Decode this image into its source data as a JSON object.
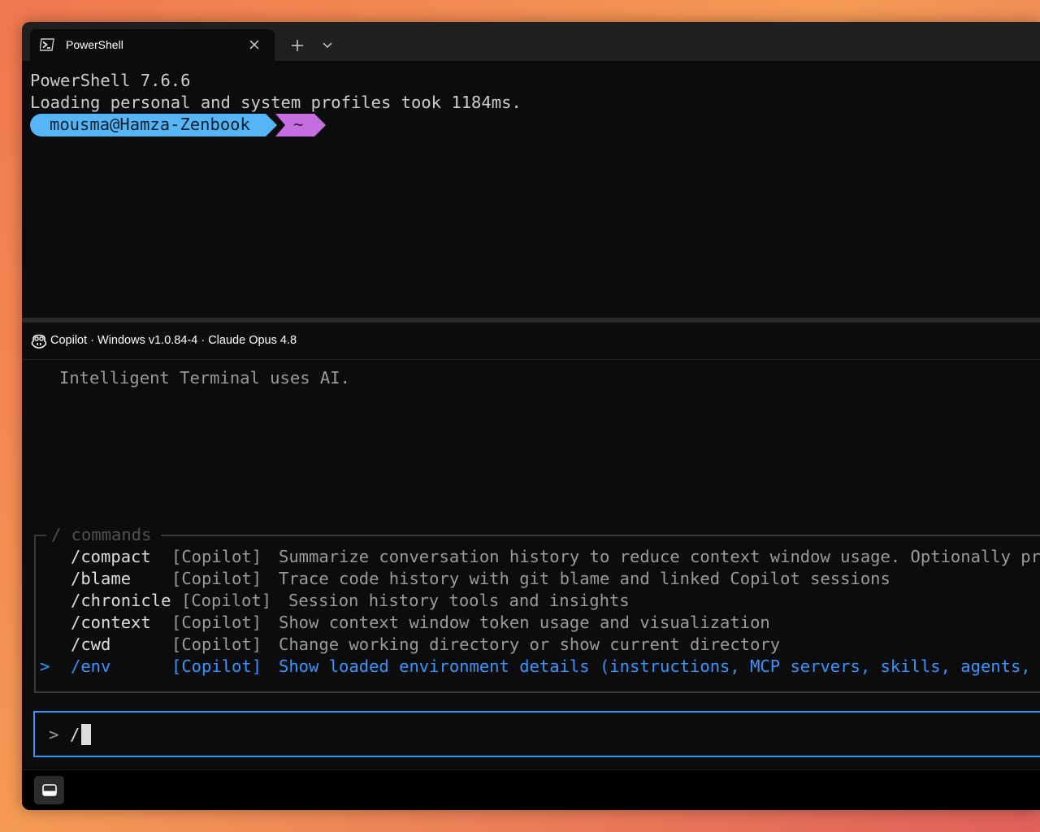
{
  "tab": {
    "title": "PowerShell",
    "icon": "powershell-icon"
  },
  "terminal": {
    "lines": [
      "PowerShell 7.6.6",
      "Loading personal and system profiles took 1184ms."
    ],
    "prompt_user": "mousma@Hamza-Zenbook",
    "prompt_path": "~",
    "colors": {
      "user_segment": "#56b5f5",
      "path_segment": "#c46ee0"
    }
  },
  "copilot": {
    "header": "Copilot · Windows v1.0.84-4 · Claude Opus 4.8",
    "intro": "Intelligent Terminal uses AI.",
    "commands_legend": "/ commands",
    "commands": [
      {
        "name": "/compact",
        "source": "[Copilot]",
        "desc": "Summarize conversation history to reduce context window usage. Optionally pro",
        "selected": false
      },
      {
        "name": "/blame",
        "source": "[Copilot]",
        "desc": "Trace code history with git blame and linked Copilot sessions",
        "selected": false
      },
      {
        "name": "/chronicle",
        "source": "[Copilot]",
        "desc": "Session history tools and insights",
        "selected": false
      },
      {
        "name": "/context",
        "source": "[Copilot]",
        "desc": "Show context window token usage and visualization",
        "selected": false
      },
      {
        "name": "/cwd",
        "source": "[Copilot]",
        "desc": "Change working directory or show current directory",
        "selected": false
      },
      {
        "name": "/env",
        "source": "[Copilot]",
        "desc": "Show loaded environment details (instructions, MCP servers, skills, agents, h",
        "selected": true
      }
    ],
    "selection_marker": ">",
    "input_prompt": ">",
    "input_value": "/",
    "accent": "#3794ff"
  }
}
